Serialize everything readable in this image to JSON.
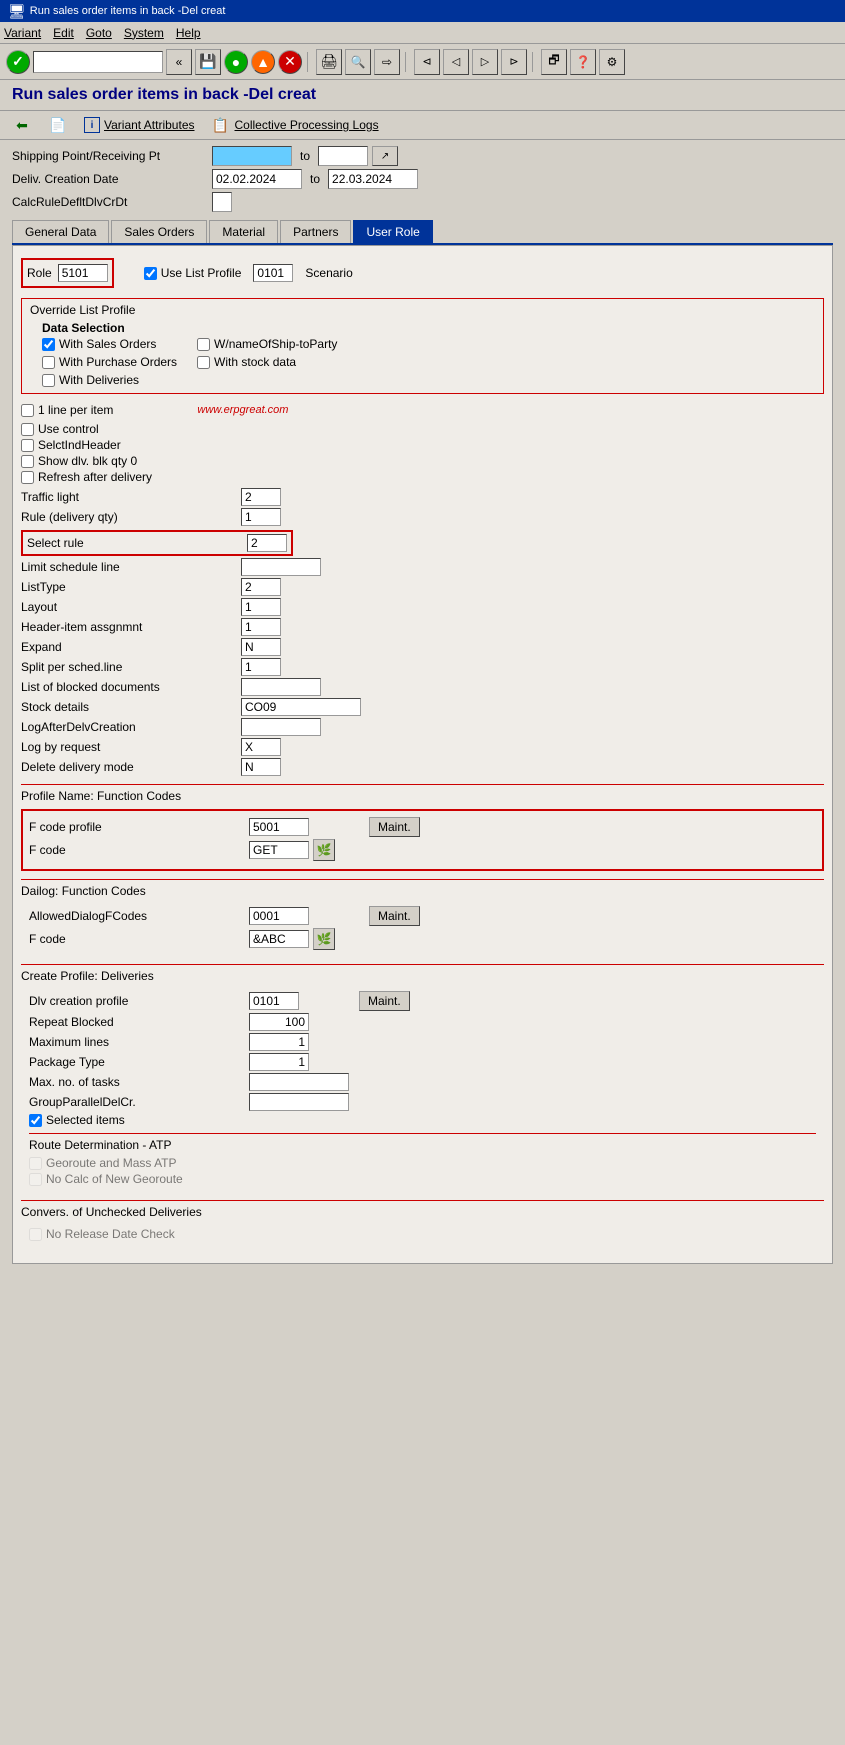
{
  "titlebar": {
    "title": "Run sales order items in back -Del creat"
  },
  "menubar": {
    "items": [
      "Variant",
      "Edit",
      "Goto",
      "System",
      "Help"
    ]
  },
  "toolbar": {
    "confirm_label": "✓",
    "back_label": "←",
    "fast_back_label": "«",
    "save_label": "💾",
    "nav1_label": "●",
    "nav2_label": "●",
    "cancel_label": "✕"
  },
  "page_title": "Run sales order items in back -Del creat",
  "action_bar": {
    "variant_attrs_label": "Variant Attributes",
    "collective_logs_label": "Collective Processing Logs"
  },
  "form": {
    "shipping_point_label": "Shipping Point/Receiving Pt",
    "shipping_point_value": "",
    "to_label": "to",
    "deliv_creation_label": "Deliv. Creation Date",
    "deliv_creation_from": "02.02.2024",
    "deliv_creation_to": "22.03.2024",
    "calc_rule_label": "CalcRuleDefltDlvCrDt"
  },
  "tabs": {
    "items": [
      "General Data",
      "Sales Orders",
      "Material",
      "Partners",
      "User Role"
    ],
    "active": "User Role"
  },
  "user_role_tab": {
    "role_label": "Role",
    "role_value": "5101",
    "use_list_profile_label": "Use List Profile",
    "use_list_profile_checked": true,
    "list_profile_value": "0101",
    "scenario_label": "Scenario",
    "override_list_profile_label": "Override List Profile",
    "data_selection_label": "Data Selection",
    "checkboxes": {
      "with_sales_orders": {
        "label": "With Sales Orders",
        "checked": true
      },
      "w_name_of_ship_to": {
        "label": "W/nameOfShip-toParty",
        "checked": false
      },
      "with_purchase_orders": {
        "label": "With Purchase Orders",
        "checked": false
      },
      "with_stock_data": {
        "label": "With stock data",
        "checked": false
      },
      "with_deliveries": {
        "label": "With Deliveries",
        "checked": false
      },
      "one_line_per_item": {
        "label": "1 line per item",
        "checked": false
      },
      "use_control": {
        "label": "Use control",
        "checked": false
      },
      "selct_ind_header": {
        "label": "SelctIndHeader",
        "checked": false
      },
      "show_dlv_blk_qty": {
        "label": "Show dlv. blk qty 0",
        "checked": false
      },
      "refresh_after_delivery": {
        "label": "Refresh after delivery",
        "checked": false
      }
    },
    "fields": {
      "traffic_light": {
        "label": "Traffic light",
        "value": "2"
      },
      "rule_delivery_qty": {
        "label": "Rule (delivery qty)",
        "value": "1"
      },
      "select_rule": {
        "label": "Select rule",
        "value": "2"
      },
      "limit_schedule_line": {
        "label": "Limit schedule line",
        "value": ""
      },
      "list_type": {
        "label": "ListType",
        "value": "2"
      },
      "layout": {
        "label": "Layout",
        "value": "1"
      },
      "header_item_assgnmnt": {
        "label": "Header-item assgnmnt",
        "value": "1"
      },
      "expand": {
        "label": "Expand",
        "value": "N"
      },
      "split_per_sched_line": {
        "label": "Split per sched.line",
        "value": "1"
      },
      "list_of_blocked_docs": {
        "label": "List of blocked documents",
        "value": ""
      },
      "stock_details": {
        "label": "Stock details",
        "value": "CO09"
      },
      "log_after_delv_creation": {
        "label": "LogAfterDelvCreation",
        "value": ""
      },
      "log_by_request": {
        "label": "Log by request",
        "value": "X"
      },
      "delete_delivery_mode": {
        "label": "Delete delivery mode",
        "value": "N"
      }
    },
    "profile_name_function_codes": {
      "title": "Profile Name: Function Codes",
      "f_code_profile_label": "F code profile",
      "f_code_profile_value": "5001",
      "maint_label": "Maint.",
      "f_code_label": "F code",
      "f_code_value": "GET"
    },
    "dialog_function_codes": {
      "title": "Dailog: Function Codes",
      "allowed_dialog_label": "AllowedDialogFCodes",
      "allowed_dialog_value": "0001",
      "maint_label": "Maint.",
      "f_code_label": "F code",
      "f_code_value": "&ABC"
    },
    "create_profile_deliveries": {
      "title": "Create Profile: Deliveries",
      "dlv_creation_profile_label": "Dlv creation profile",
      "dlv_creation_profile_value": "0101",
      "maint_label": "Maint.",
      "repeat_blocked_label": "Repeat Blocked",
      "repeat_blocked_value": "100",
      "maximum_lines_label": "Maximum lines",
      "maximum_lines_value": "1",
      "package_type_label": "Package Type",
      "package_type_value": "1",
      "max_no_tasks_label": "Max. no. of tasks",
      "max_no_tasks_value": "",
      "group_parallel_label": "GroupParallelDelCr.",
      "group_parallel_value": "",
      "selected_items_label": "Selected items",
      "selected_items_checked": true,
      "route_determination_title": "Route Determination - ATP",
      "georoute_mass_atp_label": "Georoute and Mass ATP",
      "georoute_checked": false,
      "no_calc_georoute_label": "No Calc of New Georoute",
      "no_calc_checked": false
    },
    "convers_unchecked": {
      "title": "Convers. of Unchecked Deliveries",
      "no_release_date_label": "No Release Date Check",
      "no_release_checked": false
    },
    "watermark": "www.erpgreat.com"
  }
}
